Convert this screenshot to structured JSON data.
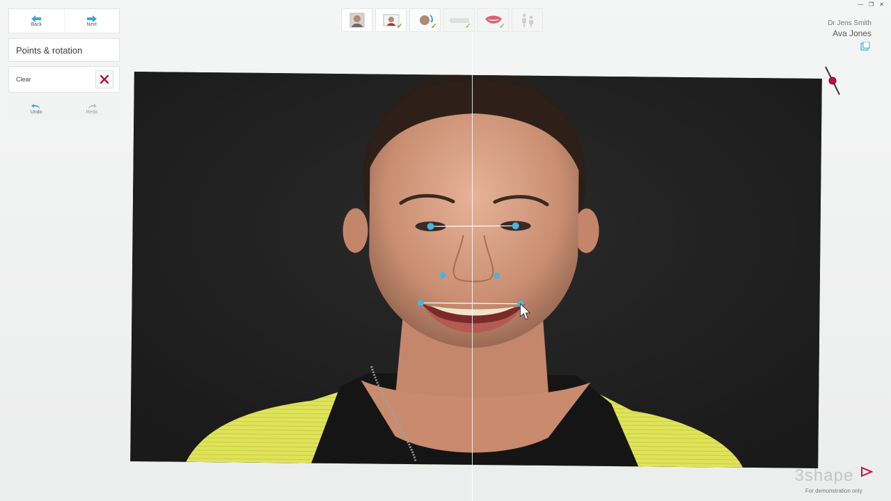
{
  "nav": {
    "back_label": "Back",
    "next_label": "Next"
  },
  "panel": {
    "title": "Points & rotation",
    "clear_label": "Clear",
    "undo_label": "Undo",
    "redo_label": "Redo"
  },
  "workflow": {
    "steps": [
      {
        "icon": "portrait-photo-icon",
        "completed": false
      },
      {
        "icon": "photo-upload-icon",
        "completed": true
      },
      {
        "icon": "face-points-icon",
        "completed": true
      },
      {
        "icon": "dental-arch-icon",
        "completed": true
      },
      {
        "icon": "smile-lips-icon",
        "completed": true
      },
      {
        "icon": "presentation-icon",
        "completed": false
      }
    ]
  },
  "user": {
    "doctor": "Dr Jens Smith",
    "patient": "Ava Jones"
  },
  "brand": {
    "logo": "3shape",
    "subtitle": "For demonstration only"
  },
  "colors": {
    "accent": "#3aa8d8",
    "landmark": "#4ab4dc",
    "clear_icon": "#b0103a",
    "check": "#7ab51d",
    "brand_triangle": "#c3103a"
  }
}
